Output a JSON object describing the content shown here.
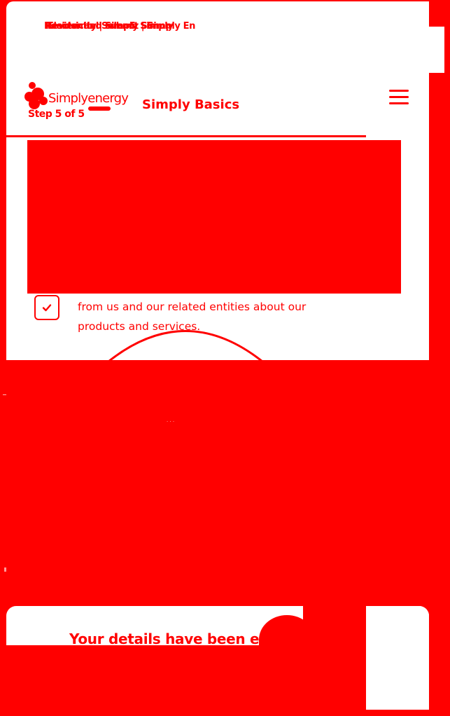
{
  "header": {
    "overlapping_texts": [
      "Residential Solar & Simply",
      "Review and submit | Simply En",
      "Electricity | Simply Sim"
    ],
    "brand_name": "Simplyenergy",
    "step_label": "Step 5 of 5",
    "plan_name": "Simply Basics"
  },
  "consent": {
    "text": "from us and our related entities about our products and services.",
    "checked": true
  },
  "confirmation": {
    "title": "Your details have been e"
  },
  "colors": {
    "accent": "#ff0000",
    "surface": "#ffffff"
  },
  "icons": {
    "menu": "hamburger-icon",
    "check": "check-icon",
    "logo": "simply-energy-logo"
  }
}
